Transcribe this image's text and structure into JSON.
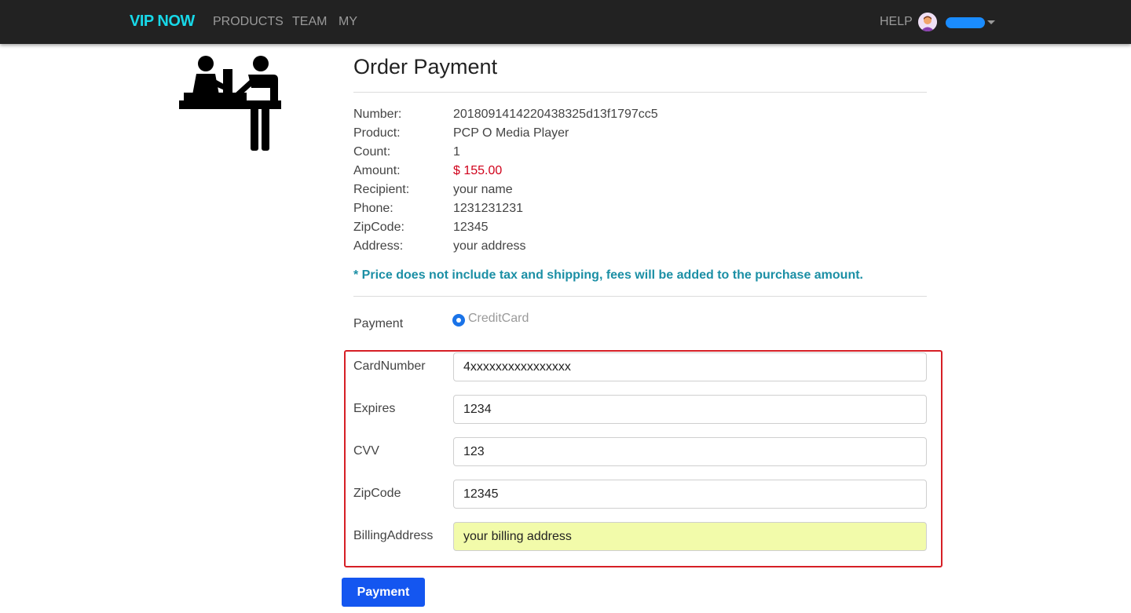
{
  "nav": {
    "brand": "VIP NOW",
    "links": [
      "PRODUCTS",
      "TEAM",
      "MY"
    ],
    "help": "HELP"
  },
  "page": {
    "title": "Order Payment"
  },
  "order": {
    "rows": [
      {
        "label": "Number:",
        "value": "201809141422043832​5d13f1797cc5"
      },
      {
        "label": "Product:",
        "value": "PCP O Media Player"
      },
      {
        "label": "Count:",
        "value": "1"
      },
      {
        "label": "Amount:",
        "value": "$ 155.00"
      },
      {
        "label": "Recipient:",
        "value": "your name"
      },
      {
        "label": "Phone:",
        "value": "1231231231"
      },
      {
        "label": "ZipCode:",
        "value": "12345"
      },
      {
        "label": "Address:",
        "value": "your address"
      }
    ],
    "notice": "* Price does not include tax and shipping, fees will be added to the purchase amount."
  },
  "payment": {
    "label": "Payment",
    "method": "CreditCard"
  },
  "card": {
    "fields": [
      {
        "label": "CardNumber",
        "value": "4xxxxxxxxxxxxxxxx"
      },
      {
        "label": "Expires",
        "value": "1234"
      },
      {
        "label": "CVV",
        "value": "123"
      },
      {
        "label": "ZipCode",
        "value": "12345"
      },
      {
        "label": "BillingAddress",
        "value": "your billing address"
      }
    ]
  },
  "actions": {
    "submit": "Payment"
  },
  "colors": {
    "brand": "#17d8e8",
    "amount": "#d0021b",
    "notice": "#1b8fa5",
    "button": "#1456f0",
    "highlight_border": "#d61f26",
    "autofill": "#f2fbaa"
  }
}
